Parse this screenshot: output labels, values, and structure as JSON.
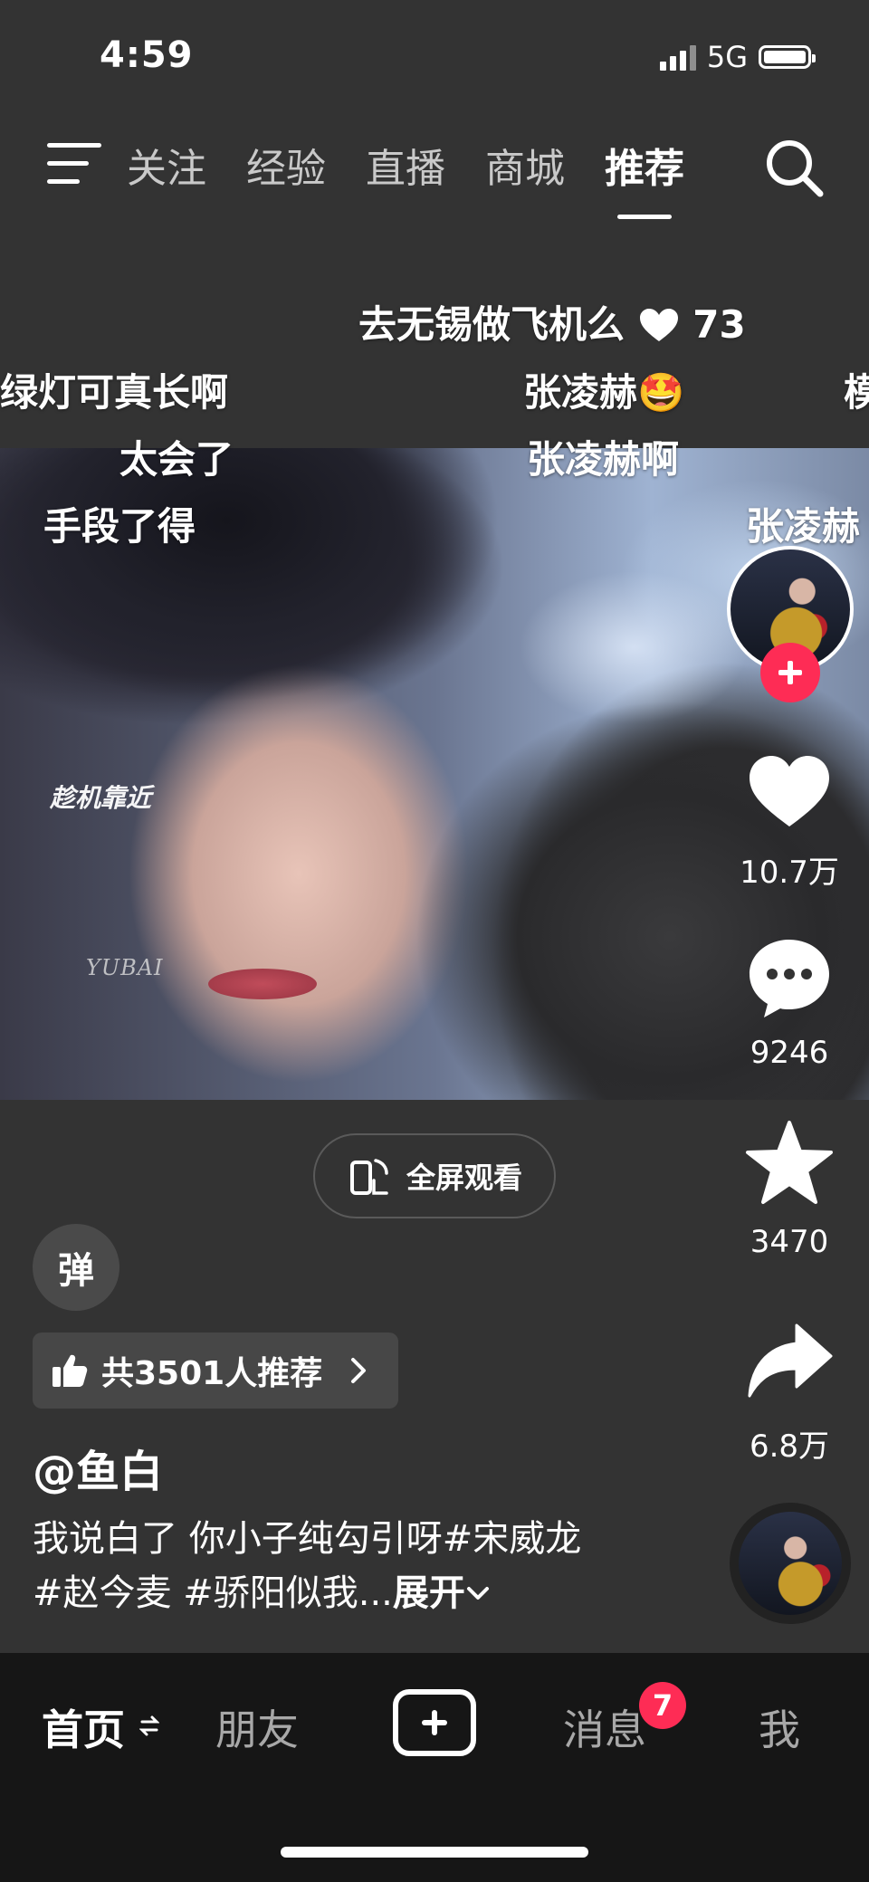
{
  "status": {
    "time": "4:59",
    "network": "5G"
  },
  "top_nav": {
    "tabs": [
      "关注",
      "经验",
      "直播",
      "商城",
      "推荐"
    ],
    "active_tab": "推荐"
  },
  "danmaku": {
    "d1": "去无锡做飞机么",
    "d1_likes": "73",
    "d2": "绿灯可真长啊",
    "d3": "张凌赫🤩",
    "d4": "模",
    "d5": "太会了",
    "d6": "张凌赫啊",
    "d7": "手段了得",
    "d8": "张凌赫"
  },
  "video": {
    "caption": "趁机靠近",
    "watermark": "YUBAI"
  },
  "actions": {
    "likes": "10.7万",
    "comments": "9246",
    "favorites": "3470",
    "shares": "6.8万"
  },
  "fullscreen_label": "全屏观看",
  "danmu_toggle_label": "弹",
  "recommend_label": "共3501人推荐",
  "author": "@鱼白",
  "description": "我说白了 你小子纯勾引呀#宋威龙 #赵今麦 #骄阳似我...",
  "expand_label": "展开",
  "bottom_nav": {
    "home": "首页",
    "friends": "朋友",
    "messages": "消息",
    "me": "我",
    "message_badge": "7"
  },
  "colors": {
    "accent": "#fe2c55",
    "background": "#333333",
    "nav_background": "#161616"
  }
}
